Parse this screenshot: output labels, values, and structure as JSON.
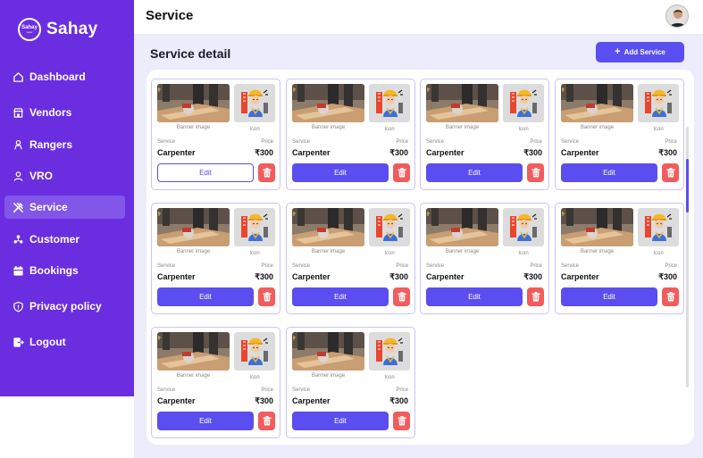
{
  "brand": {
    "logo_text": "Sahay",
    "logo_sub": "www",
    "name": "Sahay"
  },
  "sidebar": {
    "items": [
      {
        "label": "Dashboard",
        "icon": "home-icon"
      },
      {
        "label": "Vendors",
        "icon": "store-icon"
      },
      {
        "label": "Rangers",
        "icon": "ranger-icon"
      },
      {
        "label": "VRO",
        "icon": "user-icon"
      },
      {
        "label": "Service",
        "icon": "tools-icon",
        "active": true
      },
      {
        "label": "Customer",
        "icon": "people-icon"
      },
      {
        "label": "Bookings",
        "icon": "calendar-icon"
      },
      {
        "label": "Privacy policy",
        "icon": "shield-icon"
      },
      {
        "label": "Logout",
        "icon": "logout-icon"
      }
    ]
  },
  "header": {
    "title": "Service"
  },
  "main": {
    "section_title": "Service detail",
    "add_button": "Add Service"
  },
  "cards": [
    {
      "banner_caption": "Banner image",
      "icon_caption": "Icon",
      "service_label": "Service",
      "price_label": "Price",
      "service": "Carpenter",
      "price": "₹300",
      "edit_label": "Edit",
      "edit_style": "outline"
    },
    {
      "banner_caption": "Banner image",
      "icon_caption": "Icon",
      "service_label": "Service",
      "price_label": "Price",
      "service": "Carpenter",
      "price": "₹300",
      "edit_label": "Edit",
      "edit_style": "filled"
    },
    {
      "banner_caption": "Banner image",
      "icon_caption": "Icon",
      "service_label": "Service",
      "price_label": "Price",
      "service": "Carpenter",
      "price": "₹300",
      "edit_label": "Edit",
      "edit_style": "filled"
    },
    {
      "banner_caption": "Banner image",
      "icon_caption": "Icon",
      "service_label": "Service",
      "price_label": "Price",
      "service": "Carpenter",
      "price": "₹300",
      "edit_label": "Edit",
      "edit_style": "filled"
    },
    {
      "banner_caption": "Banner image",
      "icon_caption": "Icon",
      "service_label": "Service",
      "price_label": "Price",
      "service": "Carpenter",
      "price": "₹300",
      "edit_label": "Edit",
      "edit_style": "filled"
    },
    {
      "banner_caption": "Banner image",
      "icon_caption": "Icon",
      "service_label": "Service",
      "price_label": "Price",
      "service": "Carpenter",
      "price": "₹300",
      "edit_label": "Edit",
      "edit_style": "filled"
    },
    {
      "banner_caption": "Banner image",
      "icon_caption": "Icon",
      "service_label": "Service",
      "price_label": "Price",
      "service": "Carpenter",
      "price": "₹300",
      "edit_label": "Edit",
      "edit_style": "filled"
    },
    {
      "banner_caption": "Banner image",
      "icon_caption": "Icon",
      "service_label": "Service",
      "price_label": "Price",
      "service": "Carpenter",
      "price": "₹300",
      "edit_label": "Edit",
      "edit_style": "filled"
    },
    {
      "banner_caption": "Banner image",
      "icon_caption": "Icon",
      "service_label": "Service",
      "price_label": "Price",
      "service": "Carpenter",
      "price": "₹300",
      "edit_label": "Edit",
      "edit_style": "filled"
    },
    {
      "banner_caption": "Banner image",
      "icon_caption": "Icon",
      "service_label": "Service",
      "price_label": "Price",
      "service": "Carpenter",
      "price": "₹300",
      "edit_label": "Edit",
      "edit_style": "filled"
    }
  ],
  "colors": {
    "sidebar": "#6a2ee0",
    "accent": "#5b4ef0",
    "delete": "#f25c5c",
    "background": "#ececfb"
  }
}
